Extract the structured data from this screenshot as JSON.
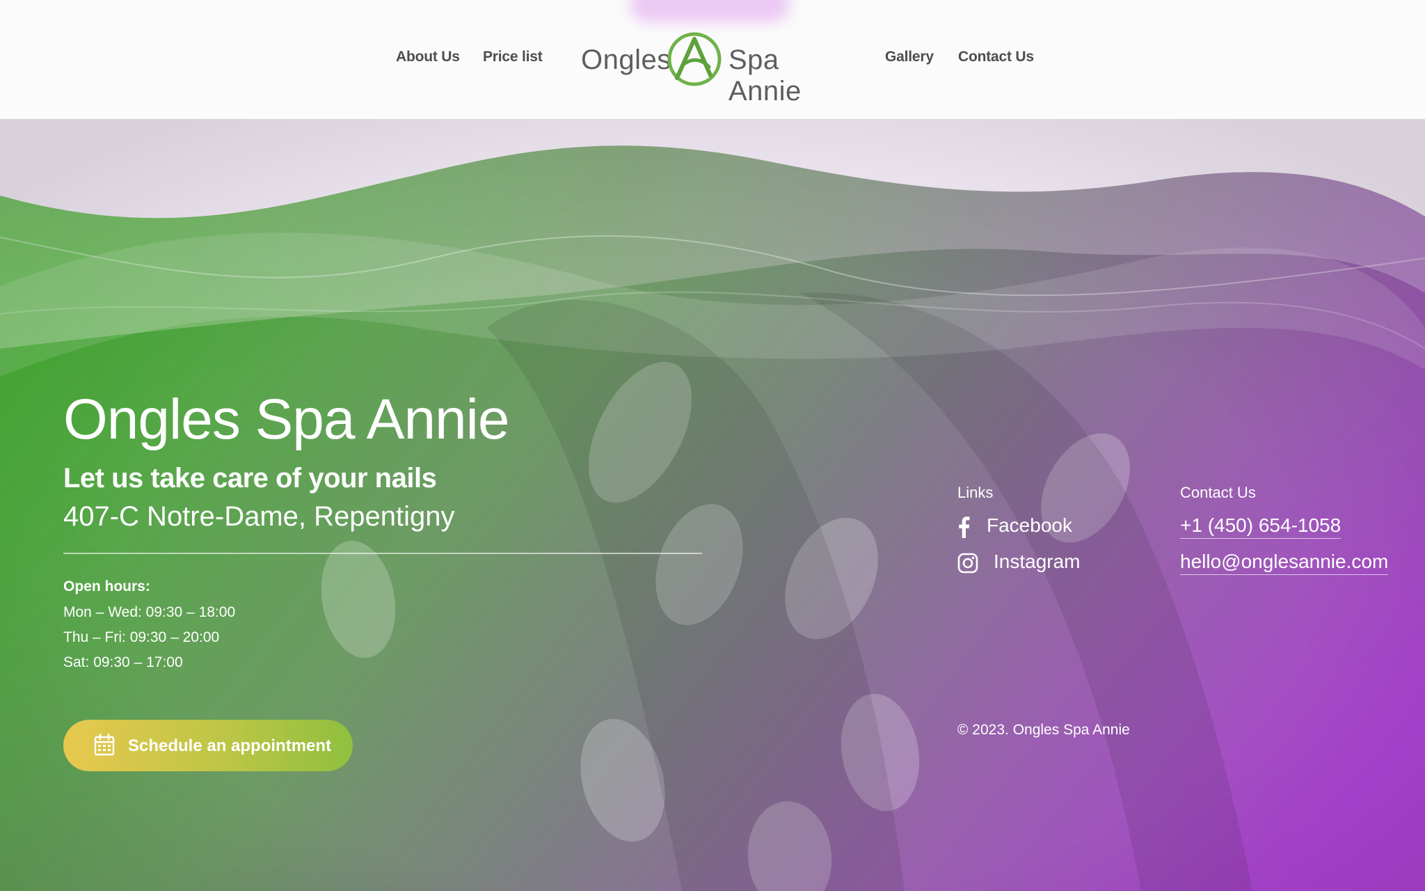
{
  "nav": {
    "about": "About Us",
    "prices": "Price list",
    "gallery": "Gallery",
    "contact": "Contact Us"
  },
  "logo": {
    "left_word": "Ongles",
    "right_word": "Spa Annie",
    "mark_icon": "letter-a-circle-logo-icon"
  },
  "hero": {
    "title": "Ongles Spa Annie",
    "tagline": "Let us take care of your nails",
    "address": "407-C Notre-Dame, Repentigny",
    "hours_label": "Open hours:",
    "hours": [
      "Mon – Wed: 09:30 – 18:00",
      "Thu – Fri: 09:30 – 20:00",
      "Sat: 09:30 – 17:00"
    ],
    "cta_label": "Schedule an appointment",
    "cta_icon": "calendar-icon"
  },
  "links": {
    "label": "Links",
    "facebook": "Facebook",
    "instagram": "Instagram"
  },
  "contact": {
    "label": "Contact Us",
    "phone": "+1 (450) 654-1058",
    "email": "hello@onglesannie.com"
  },
  "footer": {
    "copyright": "© 2023. Ongles Spa Annie"
  },
  "colors": {
    "green": "#4aa83a",
    "purple": "#a445c9",
    "cta_yellow": "#e8c84f",
    "cta_green": "#8fbf3f",
    "page_bg": "#f6eef9"
  }
}
